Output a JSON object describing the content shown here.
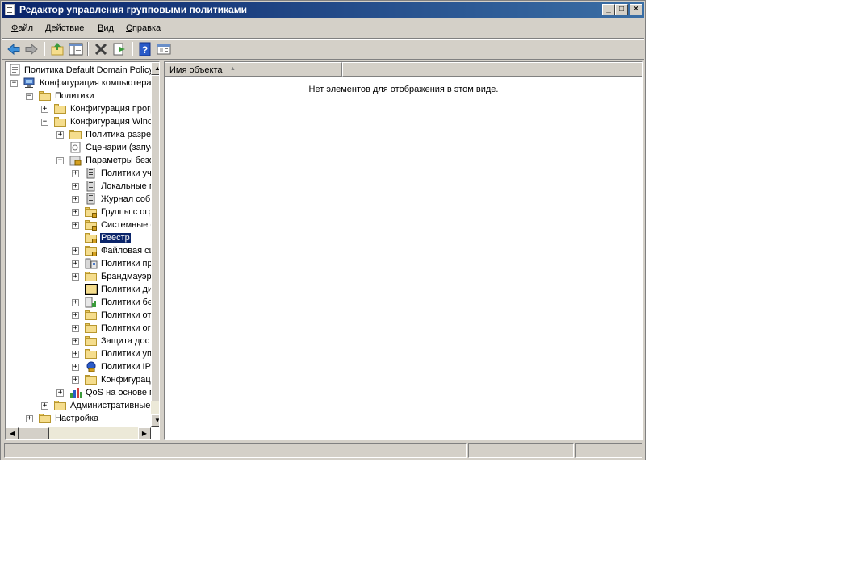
{
  "window": {
    "title": "Редактор управления групповыми политиками"
  },
  "window_buttons": {
    "minimize": "_",
    "maximize": "□",
    "close": "✕"
  },
  "menu": [
    {
      "underline": "Ф",
      "rest": "айл"
    },
    {
      "underline": "Д",
      "rest": "ействие"
    },
    {
      "underline": "В",
      "rest": "ид"
    },
    {
      "underline": "С",
      "rest": "правка"
    }
  ],
  "toolbar": [
    "back-icon",
    "forward-icon",
    "up-folder-icon",
    "show-hide-tree-icon",
    "delete-icon",
    "export-list-icon",
    "help-icon",
    "properties-icon"
  ],
  "tree": {
    "items": [
      {
        "label": "Политика Default Domain Policy",
        "icon": "policy-doc-icon"
      },
      {
        "label": "Конфигурация компьютера",
        "icon": "computer-icon"
      },
      {
        "label": "Политики",
        "icon": "folder-icon"
      },
      {
        "label": "Конфигурация программ",
        "icon": "folder-icon"
      },
      {
        "label": "Конфигурация Windows",
        "icon": "folder-icon"
      },
      {
        "label": "Политика разрешения имен",
        "icon": "folder-icon"
      },
      {
        "label": "Сценарии (запуск/завершение)",
        "icon": "script-icon"
      },
      {
        "label": "Параметры безопасности",
        "icon": "security-icon"
      },
      {
        "label": "Политики учетных записей",
        "icon": "server-icon"
      },
      {
        "label": "Локальные политики",
        "icon": "server-icon"
      },
      {
        "label": "Журнал событий",
        "icon": "server-icon"
      },
      {
        "label": "Группы с ограниченным доступом",
        "icon": "locked-folder-icon"
      },
      {
        "label": "Системные службы",
        "icon": "locked-folder-icon"
      },
      {
        "label": "Реестр",
        "icon": "locked-folder-icon"
      },
      {
        "label": "Файловая система",
        "icon": "locked-folder-icon"
      },
      {
        "label": "Политики проводной сети",
        "icon": "network-icon"
      },
      {
        "label": "Брандмауэр Windows",
        "icon": "folder-icon"
      },
      {
        "label": "Политики диспетчера списка сетей",
        "icon": "folder-icon"
      },
      {
        "label": "Политики беспроводной сети",
        "icon": "chart-icon"
      },
      {
        "label": "Политики открытого ключа",
        "icon": "folder-icon"
      },
      {
        "label": "Политики ограниченного использования программ",
        "icon": "folder-icon"
      },
      {
        "label": "Защита доступа к сети",
        "icon": "folder-icon"
      },
      {
        "label": "Политики управления приложениями",
        "icon": "folder-icon"
      },
      {
        "label": "Политики IP-безопасности",
        "icon": "ip-security-icon"
      },
      {
        "label": "Конфигурация расширенной политики аудита",
        "icon": "folder-icon"
      },
      {
        "label": "QoS на основе политики",
        "icon": "qos-chart-icon"
      },
      {
        "label": "Административные шаблоны",
        "icon": "folder-icon"
      },
      {
        "label": "Настройка",
        "icon": "folder-icon"
      }
    ]
  },
  "list": {
    "column1": "Имя объекта",
    "sort_indicator": "▲",
    "empty_message": "Нет элементов для отображения в этом виде."
  },
  "scroll": {
    "up": "▲",
    "down": "▼",
    "left": "◀",
    "right": "▶"
  }
}
